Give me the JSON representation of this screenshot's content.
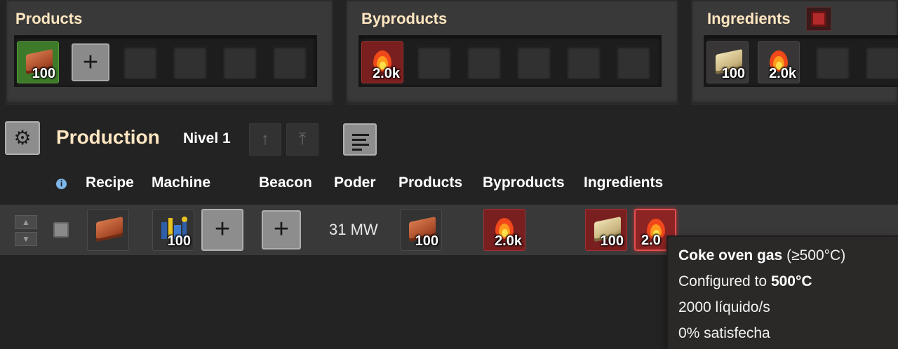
{
  "panels": {
    "products": {
      "title": "Products",
      "items": [
        {
          "icon": "brick-icon",
          "count": "100"
        }
      ]
    },
    "byproducts": {
      "title": "Byproducts",
      "items": [
        {
          "icon": "flame-icon",
          "count": "2.0k"
        }
      ]
    },
    "ingredients": {
      "title": "Ingredients",
      "items": [
        {
          "icon": "stone-brick-icon",
          "count": "100"
        },
        {
          "icon": "flame-icon",
          "count": "2.0k"
        }
      ]
    }
  },
  "production": {
    "title": "Production",
    "level": "Nivel 1"
  },
  "columns": {
    "recipe": "Recipe",
    "machine": "Machine",
    "beacon": "Beacon",
    "power": "Poder",
    "products": "Products",
    "byproducts": "Byproducts",
    "ingredients": "Ingredients"
  },
  "row": {
    "machine_count": "100",
    "power": "31 MW",
    "product_count": "100",
    "byproduct_count": "2.0k",
    "ingredient_counts": [
      "100",
      "2.0"
    ]
  },
  "tooltip": {
    "name": "Coke oven gas",
    "temp_range": "(≥500°C)",
    "configured_prefix": "Configured to",
    "configured_value": "500°C",
    "flow": "2000 líquido/s",
    "satisfaction": "0% satisfecha"
  },
  "colors": {
    "title": "#ffe6c0",
    "product_slot": "#3d7a2a",
    "byproduct_slot": "#7a1f1f",
    "info": "#7fb6e6"
  }
}
